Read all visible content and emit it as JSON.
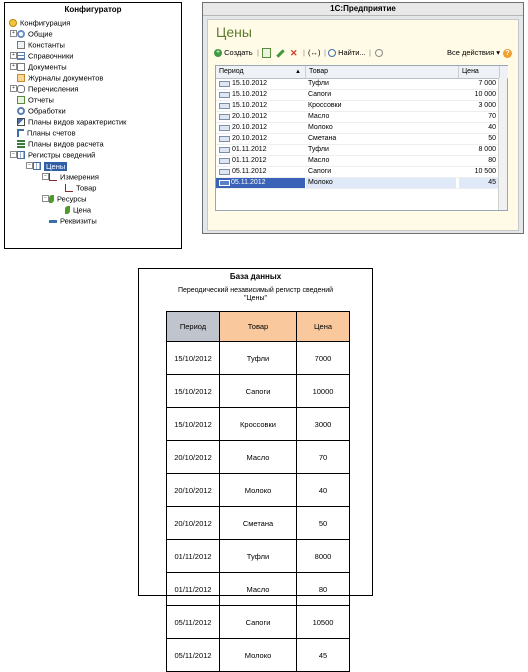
{
  "configurator": {
    "title": "Конфигуратор",
    "items": [
      {
        "label": "Конфигурация",
        "icon": "configuration-icon"
      },
      {
        "label": "Общие",
        "icon": "general-icon"
      },
      {
        "label": "Константы",
        "icon": "constants-icon"
      },
      {
        "label": "Справочники",
        "icon": "catalogs-icon"
      },
      {
        "label": "Документы",
        "icon": "documents-icon"
      },
      {
        "label": "Журналы документов",
        "icon": "document-journals-icon"
      },
      {
        "label": "Перечисления",
        "icon": "enums-icon"
      },
      {
        "label": "Отчеты",
        "icon": "reports-icon"
      },
      {
        "label": "Обработки",
        "icon": "processing-icon"
      },
      {
        "label": "Планы видов характеристик",
        "icon": "characteristic-types-icon"
      },
      {
        "label": "Планы счетов",
        "icon": "chart-of-accounts-icon"
      },
      {
        "label": "Планы видов расчета",
        "icon": "calculation-types-icon"
      },
      {
        "label": "Регистры сведений",
        "icon": "info-registers-icon"
      },
      {
        "label": "Цены",
        "icon": "register-icon"
      },
      {
        "label": "Измерения",
        "icon": "dimensions-icon"
      },
      {
        "label": "Товар",
        "icon": "dimension-item-icon"
      },
      {
        "label": "Ресурсы",
        "icon": "resources-icon"
      },
      {
        "label": "Цена",
        "icon": "resource-item-icon"
      },
      {
        "label": "Реквизиты",
        "icon": "attributes-icon"
      }
    ]
  },
  "app": {
    "window_title": "1С:Предприятие",
    "form_title": "Цены",
    "toolbar": {
      "create_label": "Создать",
      "find_label": "Найти...",
      "all_actions_label": "Все действия"
    },
    "columns": {
      "period": "Период",
      "product": "Товар",
      "price": "Цена"
    },
    "rows": [
      {
        "date": "15.10.2012",
        "product": "Туфли",
        "price": "7 000"
      },
      {
        "date": "15.10.2012",
        "product": "Сапоги",
        "price": "10 000"
      },
      {
        "date": "15.10.2012",
        "product": "Кроссовки",
        "price": "3 000"
      },
      {
        "date": "20.10.2012",
        "product": "Масло",
        "price": "70"
      },
      {
        "date": "20.10.2012",
        "product": "Молоко",
        "price": "40"
      },
      {
        "date": "20.10.2012",
        "product": "Сметана",
        "price": "50"
      },
      {
        "date": "01.11.2012",
        "product": "Туфли",
        "price": "8 000"
      },
      {
        "date": "01.11.2012",
        "product": "Масло",
        "price": "80"
      },
      {
        "date": "05.11.2012",
        "product": "Сапоги",
        "price": "10 500"
      },
      {
        "date": "05.11.2012",
        "product": "Молоко",
        "price": "45"
      }
    ]
  },
  "database": {
    "title": "База данных",
    "subtitle_line1": "Переодический независимый регистр сведений",
    "subtitle_line2": "\"Цены\"",
    "headers": {
      "period": "Период",
      "product": "Товар",
      "price": "Цена"
    },
    "header_colors": {
      "period": "#c0c4cc",
      "product": "#f9c89c",
      "price": "#f9c89c"
    },
    "rows": [
      {
        "date": "15/10/2012",
        "product": "Туфли",
        "price": "7000"
      },
      {
        "date": "15/10/2012",
        "product": "Сапоги",
        "price": "10000"
      },
      {
        "date": "15/10/2012",
        "product": "Кроссовки",
        "price": "3000"
      },
      {
        "date": "20/10/2012",
        "product": "Масло",
        "price": "70"
      },
      {
        "date": "20/10/2012",
        "product": "Молоко",
        "price": "40"
      },
      {
        "date": "20/10/2012",
        "product": "Сметана",
        "price": "50"
      },
      {
        "date": "01/11/2012",
        "product": "Туфли",
        "price": "8000"
      },
      {
        "date": "01/11/2012",
        "product": "Масло",
        "price": "80"
      },
      {
        "date": "05/11/2012",
        "product": "Сапоги",
        "price": "10500"
      },
      {
        "date": "05/11/2012",
        "product": "Молоко",
        "price": "45"
      }
    ]
  }
}
